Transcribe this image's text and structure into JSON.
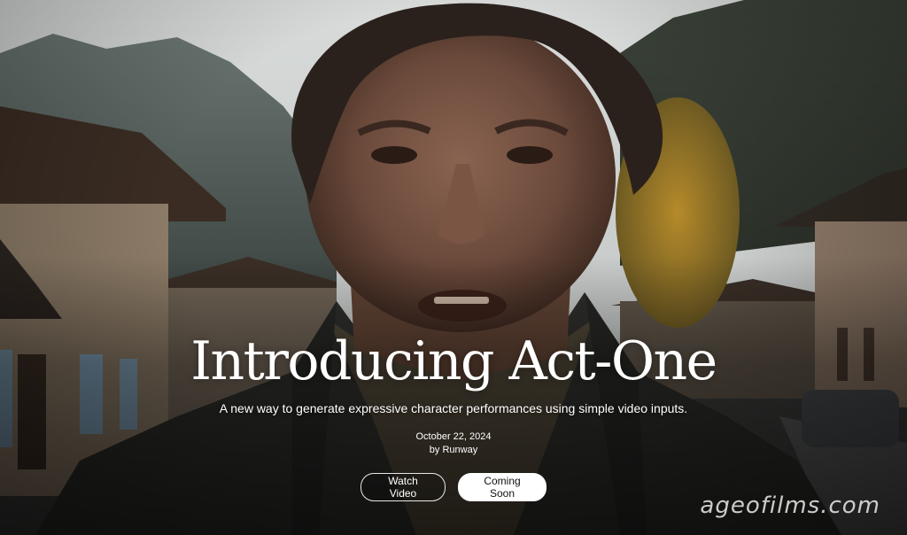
{
  "hero": {
    "title": "Introducing Act-One",
    "subtitle": "A new way to generate expressive character performances using simple video inputs.",
    "date": "October 22, 2024",
    "author": "by Runway"
  },
  "buttons": {
    "watch_label": "Watch Video",
    "coming_label": "Coming Soon"
  },
  "watermark": "ageofilms.com",
  "colors": {
    "text": "#ffffff",
    "button_solid_bg": "#ffffff",
    "button_solid_text": "#111111"
  }
}
